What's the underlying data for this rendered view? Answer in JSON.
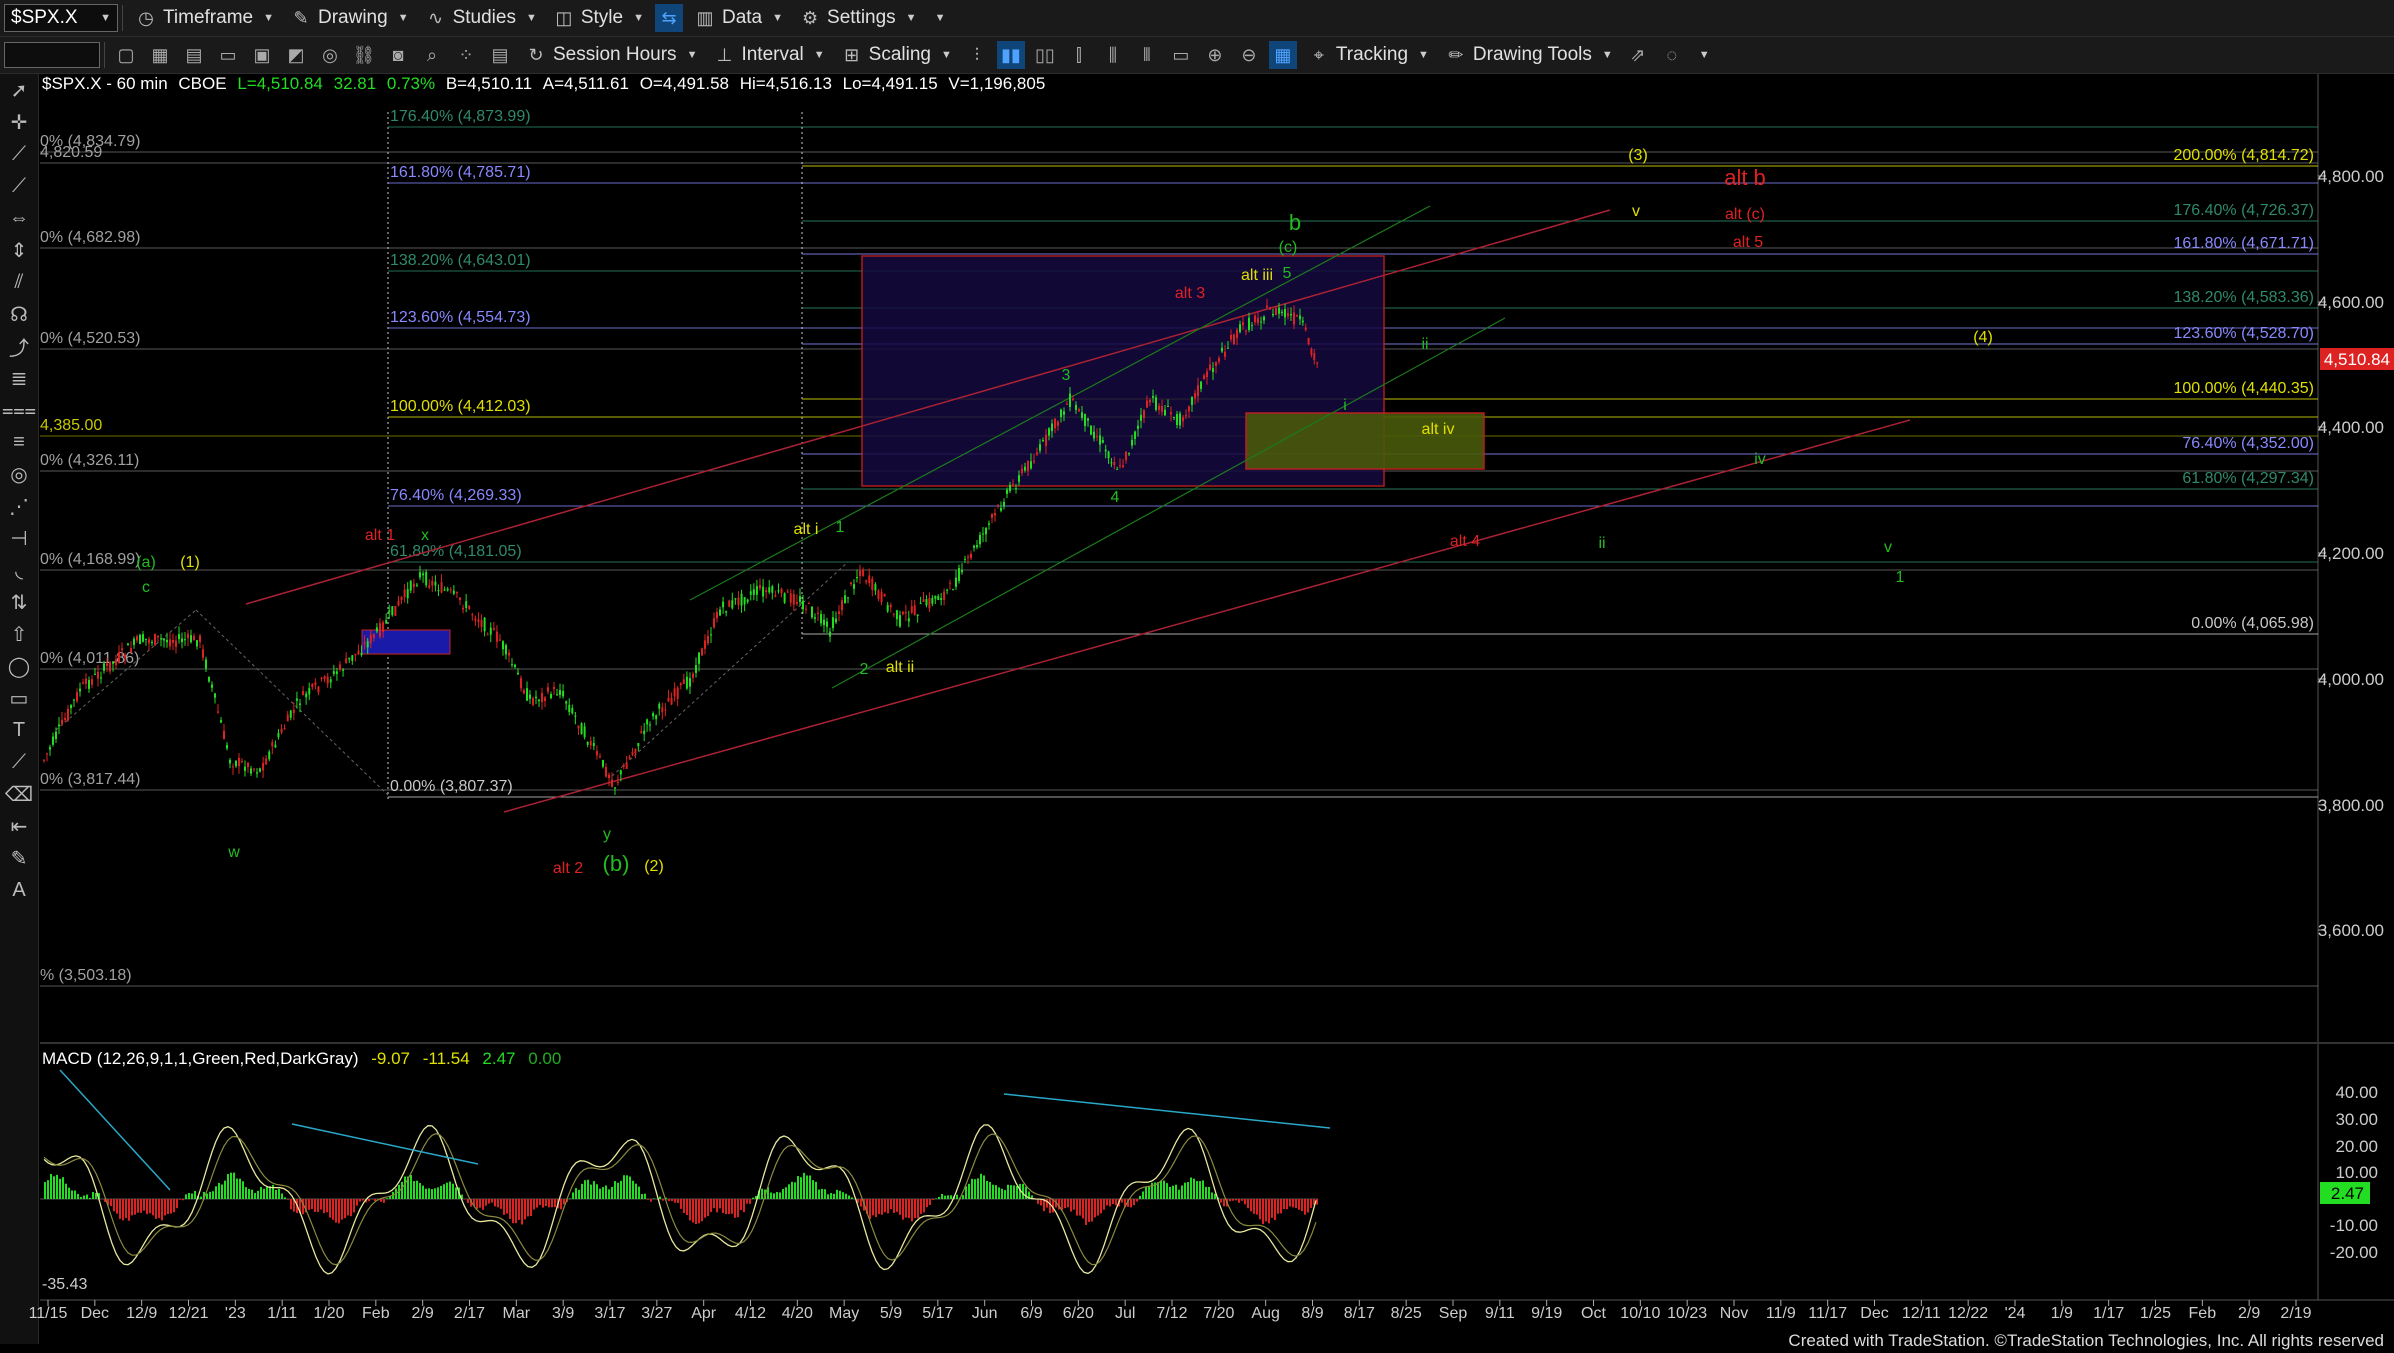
{
  "toolbar1": {
    "symbol": "$SPX.X",
    "timeframe": "Timeframe",
    "drawing": "Drawing",
    "studies": "Studies",
    "style": "Style",
    "data": "Data",
    "settings": "Settings"
  },
  "toolbar2": {
    "session": "Session Hours",
    "interval": "Interval",
    "scaling": "Scaling",
    "tracking": "Tracking",
    "drawing_tools": "Drawing Tools"
  },
  "header": {
    "symbol": "$SPX.X - 60 min",
    "exchange": "CBOE",
    "last": "L=4,510.84",
    "change": "32.81",
    "pct": "0.73%",
    "bid": "B=4,510.11",
    "ask": "A=4,511.61",
    "open": "O=4,491.58",
    "high": "Hi=4,516.13",
    "low": "Lo=4,491.15",
    "vol": "V=1,196,805"
  },
  "macd_header": {
    "name": "MACD (12,26,9,1,1,Green,Red,DarkGray)",
    "v1": "-9.07",
    "v2": "-11.54",
    "v3": "2.47",
    "v4": "0.00"
  },
  "price_axis": {
    "ticks": [
      "4,800.00",
      "4,600.00",
      "4,400.00",
      "4,200.00",
      "4,000.00",
      "3,800.00",
      "3,600.00"
    ],
    "current": "4,510.84"
  },
  "macd_axis": {
    "ticks": [
      "40.00",
      "30.00",
      "20.00",
      "10.00",
      "-10.00",
      "-20.00"
    ],
    "current": "2.47",
    "min_label": "-35.43"
  },
  "date_axis": [
    "11/15",
    "Dec",
    "12/9",
    "12/21",
    "'23",
    "1/11",
    "1/20",
    "Feb",
    "2/9",
    "2/17",
    "Mar",
    "3/9",
    "3/17",
    "3/27",
    "Apr",
    "4/12",
    "4/20",
    "May",
    "5/9",
    "5/17",
    "Jun",
    "6/9",
    "6/20",
    "Jul",
    "7/12",
    "7/20",
    "Aug",
    "8/9",
    "8/17",
    "8/25",
    "Sep",
    "9/11",
    "9/19",
    "Oct",
    "10/10",
    "10/23",
    "Nov",
    "11/9",
    "11/17",
    "Dec",
    "12/11",
    "12/22",
    "'24",
    "1/9",
    "1/17",
    "1/25",
    "Feb",
    "2/9",
    "2/19"
  ],
  "left_fib_labels": [
    {
      "t": "0% (4,834.79)",
      "c": "#a0a0a0"
    },
    {
      "t": "4,820.59",
      "c": "#a0a0a0"
    },
    {
      "t": "0% (4,682.98)",
      "c": "#a0a0a0"
    },
    {
      "t": "0% (4,520.53)",
      "c": "#a0a0a0"
    },
    {
      "t": "4,385.00",
      "c": "#c8c800"
    },
    {
      "t": "0% (4,326.11)",
      "c": "#a0a0a0"
    },
    {
      "t": "0% (4,168.99)",
      "c": "#a0a0a0"
    },
    {
      "t": "0% (4,011.86)",
      "c": "#a0a0a0"
    },
    {
      "t": "0% (3,817.44)",
      "c": "#a0a0a0"
    },
    {
      "t": "% (3,503.18)",
      "c": "#a0a0a0"
    }
  ],
  "mid_fib_labels": [
    {
      "t": "176.40% (4,873.99)",
      "c": "#2f8a6a"
    },
    {
      "t": "161.80% (4,785.71)",
      "c": "#8888ff"
    },
    {
      "t": "138.20% (4,643.01)",
      "c": "#2f8a6a"
    },
    {
      "t": "123.60% (4,554.73)",
      "c": "#8888ff"
    },
    {
      "t": "100.00% (4,412.03)",
      "c": "#e0e000"
    },
    {
      "t": "76.40% (4,269.33)",
      "c": "#8888ff"
    },
    {
      "t": "61.80% (4,181.05)",
      "c": "#2f8a6a"
    },
    {
      "t": "0.00% (3,807.37)",
      "c": "#c8c8c8"
    }
  ],
  "right_fib_labels": [
    {
      "t": "200.00% (4,814.72)",
      "c": "#e0e000"
    },
    {
      "t": "176.40% (4,726.37)",
      "c": "#2f8a6a"
    },
    {
      "t": "161.80% (4,671.71)",
      "c": "#8888ff"
    },
    {
      "t": "138.20% (4,583.36)",
      "c": "#2f8a6a"
    },
    {
      "t": "123.60% (4,528.70)",
      "c": "#8888ff"
    },
    {
      "t": "100.00% (4,440.35)",
      "c": "#e0e000"
    },
    {
      "t": "76.40% (4,352.00)",
      "c": "#8888ff"
    },
    {
      "t": "61.80% (4,297.34)",
      "c": "#2f8a6a"
    },
    {
      "t": "0.00% (4,065.98)",
      "c": "#c8c8c8"
    }
  ],
  "wave_labels": [
    {
      "t": "(a)",
      "c": "#22bb22"
    },
    {
      "t": "(1)",
      "c": "#e0e000"
    },
    {
      "t": "c",
      "c": "#22bb22"
    },
    {
      "t": "w",
      "c": "#22bb22"
    },
    {
      "t": "alt 1",
      "c": "#dd2222"
    },
    {
      "t": "x",
      "c": "#22bb22"
    },
    {
      "t": "y",
      "c": "#22bb22"
    },
    {
      "t": "alt 2",
      "c": "#dd2222"
    },
    {
      "t": "(b)",
      "c": "#22bb22"
    },
    {
      "t": "(2)",
      "c": "#e0e000"
    },
    {
      "t": "alt i",
      "c": "#e0e000"
    },
    {
      "t": "1",
      "c": "#22bb22"
    },
    {
      "t": "2",
      "c": "#22bb22"
    },
    {
      "t": "alt ii",
      "c": "#e0e000"
    },
    {
      "t": "3",
      "c": "#22bb22"
    },
    {
      "t": "4",
      "c": "#22bb22"
    },
    {
      "t": "alt 3",
      "c": "#dd2222"
    },
    {
      "t": "alt iii",
      "c": "#e0e000"
    },
    {
      "t": "5",
      "c": "#22bb22"
    },
    {
      "t": "(c)",
      "c": "#22bb22"
    },
    {
      "t": "b",
      "c": "#22bb22"
    },
    {
      "t": "ii",
      "c": "#22bb22"
    },
    {
      "t": "i",
      "c": "#22bb22"
    },
    {
      "t": "alt iv",
      "c": "#e0e000"
    },
    {
      "t": "alt 4",
      "c": "#dd2222"
    },
    {
      "t": "ii",
      "c": "#22bb22"
    },
    {
      "t": "(3)",
      "c": "#e0e000"
    },
    {
      "t": "v",
      "c": "#e0e000"
    },
    {
      "t": "alt b",
      "c": "#dd2222"
    },
    {
      "t": "alt (c)",
      "c": "#dd2222"
    },
    {
      "t": "alt 5",
      "c": "#dd2222"
    },
    {
      "t": "(4)",
      "c": "#e0e000"
    },
    {
      "t": "iv",
      "c": "#22bb22"
    },
    {
      "t": "v",
      "c": "#22bb22"
    },
    {
      "t": "1",
      "c": "#22bb22"
    }
  ],
  "footer": "Created with TradeStation. ©TradeStation Technologies, Inc. All rights reserved",
  "colors": {
    "up": "#22dd22",
    "down": "#dd2222",
    "green": "#22bb22",
    "yellow": "#e0e000",
    "red": "#dd2222",
    "blue": "#8888ff"
  }
}
